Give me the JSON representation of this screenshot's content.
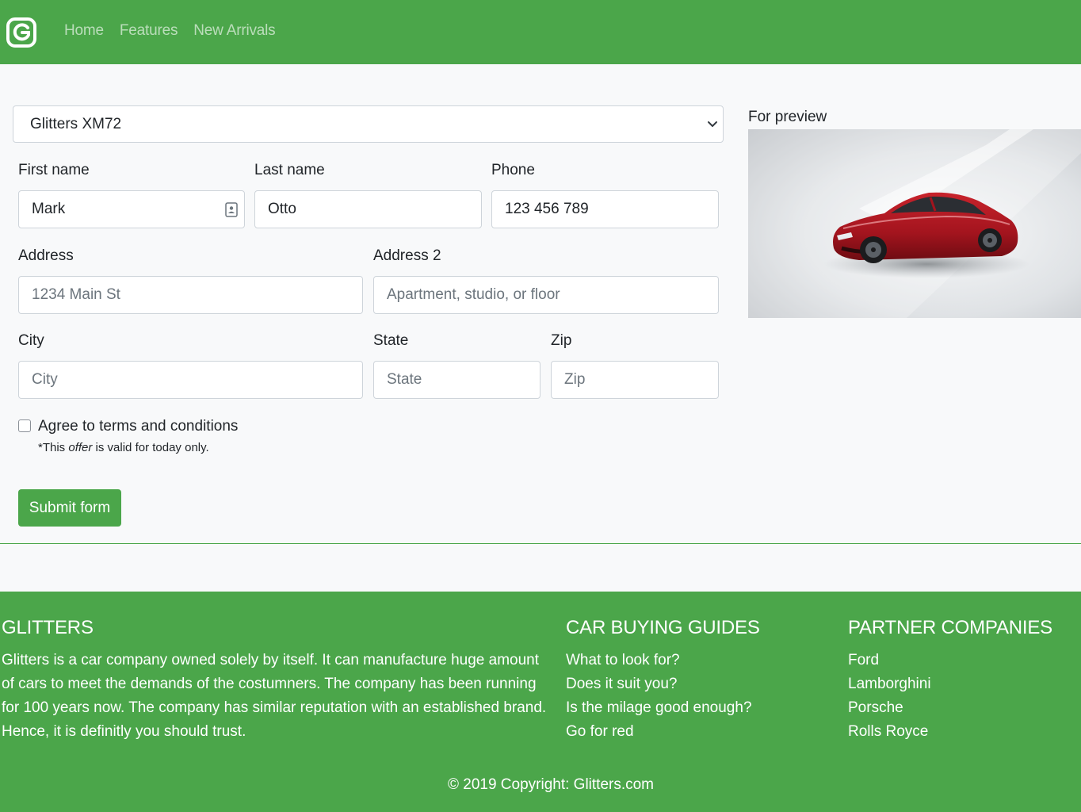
{
  "nav": {
    "logo_letter": "G",
    "links": [
      "Home",
      "Features",
      "New Arrivals"
    ]
  },
  "form": {
    "model_select": "Glitters XM72",
    "first_name": {
      "label": "First name",
      "value": "Mark"
    },
    "last_name": {
      "label": "Last name",
      "value": "Otto"
    },
    "phone": {
      "label": "Phone",
      "value": "123 456 789"
    },
    "address": {
      "label": "Address",
      "placeholder": "1234 Main St"
    },
    "address2": {
      "label": "Address 2",
      "placeholder": "Apartment, studio, or floor"
    },
    "city": {
      "label": "City",
      "placeholder": "City"
    },
    "state": {
      "label": "State",
      "placeholder": "State"
    },
    "zip": {
      "label": "Zip",
      "placeholder": "Zip"
    },
    "terms_label": "Agree to terms and conditions",
    "note_before": "*This",
    "note_em": "offer",
    "note_after": "is valid for today only.",
    "submit_label": "Submit form"
  },
  "preview": {
    "label": "For preview"
  },
  "footer": {
    "about_title": "GLITTERS",
    "about_text": "Glitters is a car company owned solely by itself. It can manufacture huge amount of cars to meet the demands of the costumners. The company has been running for 100 years now. The company has similar reputation with an established brand. Hence, it is definitly you should trust.",
    "guides_title": "CAR BUYING GUIDES",
    "guides": [
      "What to look for?",
      "Does it suit you?",
      "Is the milage good enough?",
      "Go for red"
    ],
    "partners_title": "PARTNER COMPANIES",
    "partners": [
      "Ford",
      "Lamborghini",
      "Porsche",
      "Rolls Royce"
    ],
    "copyright": "© 2019 Copyright: Glitters.com"
  },
  "colors": {
    "brand_green": "#4ba64a",
    "page_bg": "#f8f9fa",
    "car_red": "#a3141e"
  }
}
